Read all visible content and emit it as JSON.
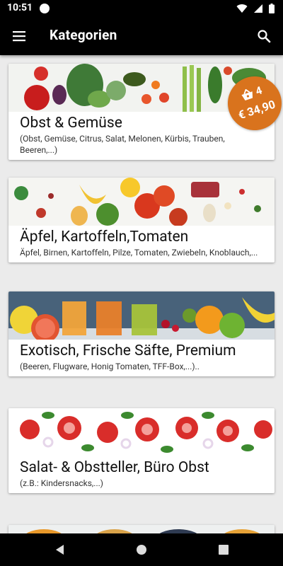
{
  "status": {
    "time": "10:51"
  },
  "toolbar": {
    "title": "Kategorien"
  },
  "cart": {
    "count": "4",
    "price": "€ 34,90"
  },
  "categories": [
    {
      "name": "Obst & Gemüse",
      "desc": "(Obst, Gemüse, Citrus, Salat, Melonen, Kürbis, Trauben, Beeren,...)"
    },
    {
      "name": "Äpfel, Kartoffeln,Tomaten",
      "desc": "Äpfel, Birnen, Kartoffeln, Pilze, Tomaten, Zwiebeln, Knoblauch,..."
    },
    {
      "name": "Exotisch, Frische Säfte, Premium",
      "desc": "(Beeren, Flugware, Honig Tomaten, TFF-Box,...).."
    },
    {
      "name": "Salat- & Obstteller, Büro Obst",
      "desc": "(z.B.: Kindersnacks,...)"
    }
  ],
  "colors": {
    "accent": "#d9731d",
    "bar": "#000000",
    "card": "#ffffff",
    "background": "#ebebeb"
  }
}
